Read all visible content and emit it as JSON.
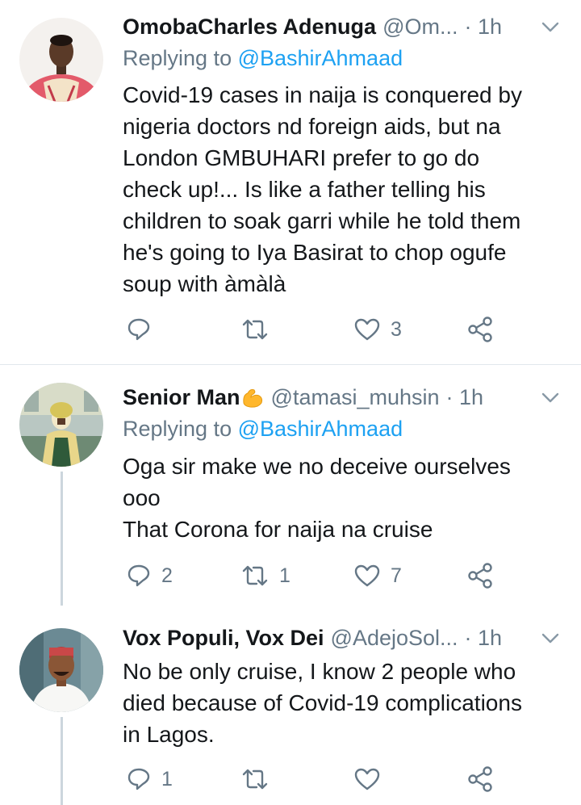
{
  "tweets": [
    {
      "name": "OmobaCharles Adenuga",
      "handle": "@Om...",
      "time": "· 1h",
      "replying_prefix": "Replying to ",
      "replying_handle": "@BashirAhmaad",
      "lines": [
        "Covid-19 cases in naija is conquered by",
        "nigeria doctors nd foreign aids, but na",
        "London GMBUHARI prefer to go do",
        "check up!... Is like a father telling his",
        "children to soak garri while he told them",
        "he's going to Iya Basirat to chop ogufe",
        "soup with àmàlà"
      ],
      "replies": "",
      "retweets": "",
      "likes": "3"
    },
    {
      "name": "Senior Man",
      "handle": "@tamasi_muhsin",
      "time": "· 1h",
      "replying_prefix": "Replying to ",
      "replying_handle": "@BashirAhmaad",
      "lines": [
        "Oga sir make we no deceive ourselves",
        "ooo",
        "That Corona for naija na cruise"
      ],
      "replies": "2",
      "retweets": "1",
      "likes": "7"
    },
    {
      "name": "Vox Populi, Vox Dei",
      "handle": "@AdejoSol...",
      "time": "· 1h",
      "lines": [
        "No be only cruise, I know 2 people who",
        "died because of Covid-19 complications",
        "in Lagos."
      ],
      "replies": "1",
      "retweets": "",
      "likes": ""
    }
  ],
  "colors": {
    "text": "#14171a",
    "secondary": "#657786",
    "mention": "#1da1f2",
    "divider": "#e1e8ed",
    "thread_line": "#ccd6dd"
  },
  "icons": [
    "reply-icon",
    "retweet-icon",
    "like-icon",
    "share-icon",
    "chevron-down-icon",
    "flexed-biceps-emoji"
  ]
}
